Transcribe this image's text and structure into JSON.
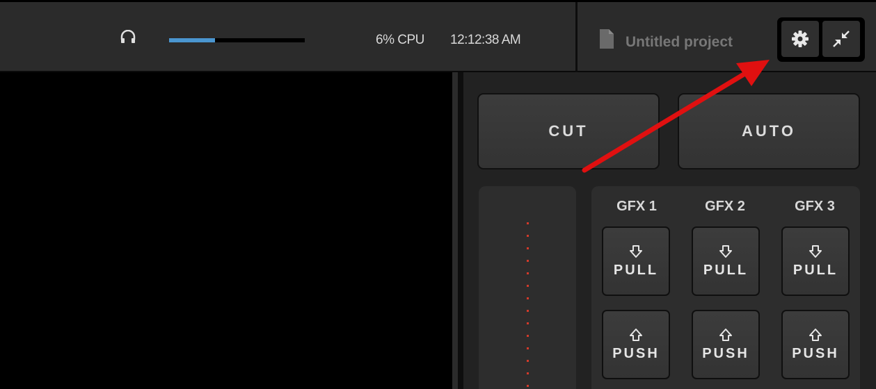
{
  "topbar": {
    "volume_level": 0.34,
    "cpu": "6% CPU",
    "clock": "12:12:38 AM",
    "project_title": "Untitled project",
    "icons": [
      "headphones-icon",
      "document-icon",
      "gear-icon",
      "collapse-icon"
    ]
  },
  "switcher": {
    "cut_label": "CUT",
    "auto_label": "AUTO",
    "gfx": [
      {
        "label": "GFX 1",
        "pull": "PULL",
        "push": "PUSH"
      },
      {
        "label": "GFX 2",
        "pull": "PULL",
        "push": "PUSH"
      },
      {
        "label": "GFX 3",
        "pull": "PULL",
        "push": "PUSH"
      }
    ]
  },
  "colors": {
    "volume_fill": "#4a96d0",
    "annotation_arrow": "#e01010",
    "tbar_indicator": "#d23a2a"
  }
}
